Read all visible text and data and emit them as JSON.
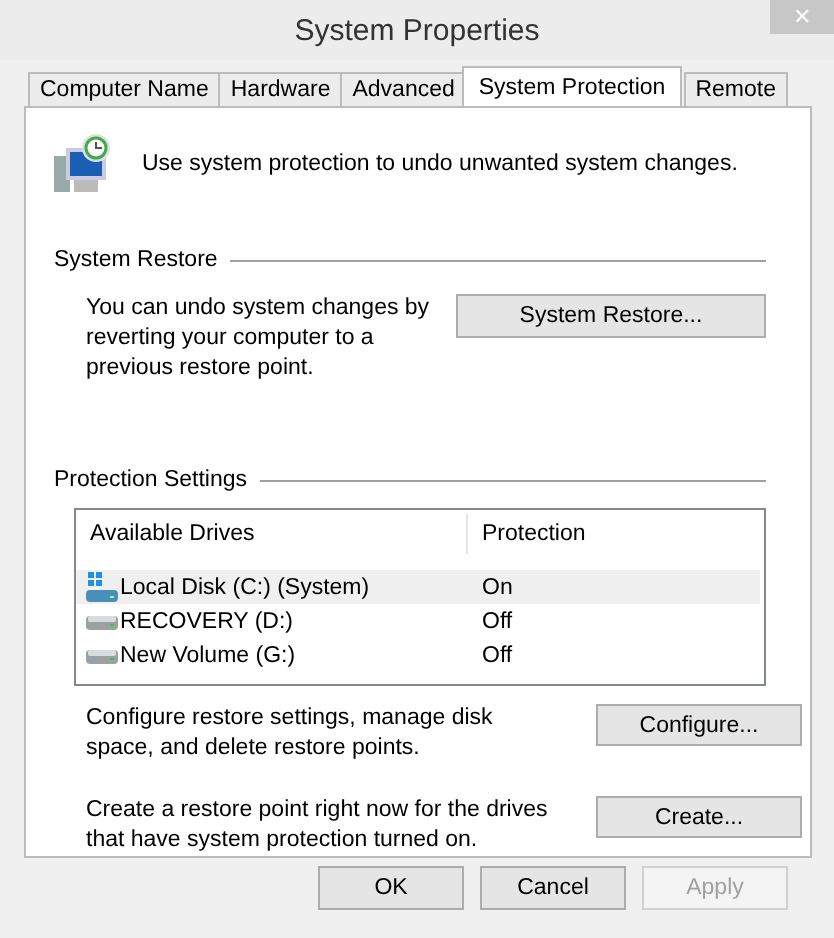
{
  "window": {
    "title": "System Properties",
    "close": "✕"
  },
  "tabs": [
    {
      "label": "Computer Name",
      "selected": false
    },
    {
      "label": "Hardware",
      "selected": false
    },
    {
      "label": "Advanced",
      "selected": false
    },
    {
      "label": "System Protection",
      "selected": true
    },
    {
      "label": "Remote",
      "selected": false
    }
  ],
  "intro": "Use system protection to undo unwanted system changes.",
  "system_restore": {
    "heading": "System Restore",
    "text": "You can undo system changes by reverting your computer to a previous restore point.",
    "button": "System Restore..."
  },
  "protection_settings": {
    "heading": "Protection Settings",
    "columns": [
      "Available Drives",
      "Protection"
    ],
    "drives": [
      {
        "name": "Local Disk (C:) (System)",
        "protection": "On",
        "kind": "system",
        "selected": true
      },
      {
        "name": "RECOVERY (D:)",
        "protection": "Off",
        "kind": "disk",
        "selected": false
      },
      {
        "name": "New Volume (G:)",
        "protection": "Off",
        "kind": "disk",
        "selected": false
      }
    ],
    "configure": {
      "text": "Configure restore settings, manage disk space, and delete restore points.",
      "button": "Configure..."
    },
    "create": {
      "text": "Create a restore point right now for the drives that have system protection turned on.",
      "button": "Create..."
    }
  },
  "buttons": [
    {
      "label": "OK",
      "disabled": false
    },
    {
      "label": "Cancel",
      "disabled": false
    },
    {
      "label": "Apply",
      "disabled": true
    }
  ]
}
